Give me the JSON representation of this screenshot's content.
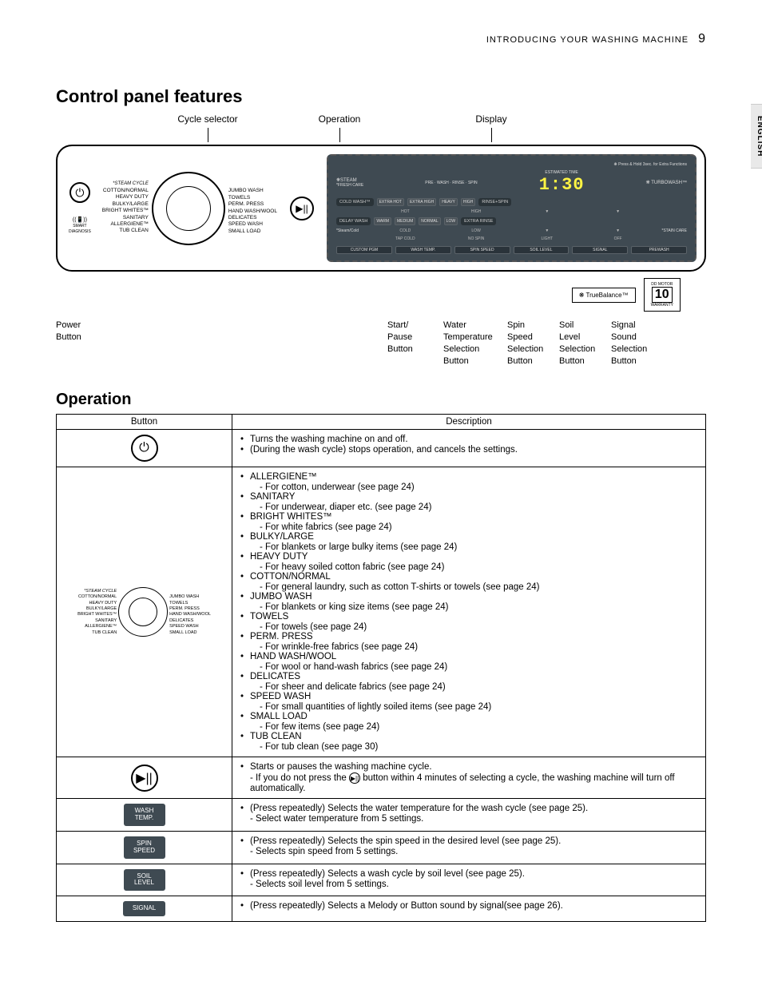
{
  "header": {
    "section": "INTRODUCING YOUR WASHING MACHINE",
    "page": "9"
  },
  "lang_tab": "ENGLISH",
  "h_panel": "Control panel features",
  "top_labels": {
    "cycle": "Cycle selector",
    "operation": "Operation",
    "display": "Display"
  },
  "cycles_header": "*STEAM CYCLE",
  "cycles_left": [
    "COTTON/NORMAL",
    "HEAVY DUTY",
    "BULKY/LARGE",
    "BRIGHT WHITES™",
    "SANITARY",
    "ALLERGIENE™",
    "TUB CLEAN"
  ],
  "cycles_right": [
    "JUMBO WASH",
    "TOWELS",
    "PERM. PRESS",
    "HAND WASH/WOOL",
    "DELICATES",
    "SPEED WASH",
    "SMALL LOAD"
  ],
  "start_glyph": "▶||",
  "display": {
    "time": "1:30",
    "hold_note": "❋ Press & Hold 3sec. for Extra Functions",
    "steam": "❋STEAM",
    "fresh": "*FRESH CARE",
    "progress": "PRE · WASH · RINSE · SPIN",
    "est_label": "ESTIMATED TIME",
    "turbo": "❋ TURBOWASH™",
    "left_btns": [
      "COLD WASH™",
      "DELAY WASH",
      "CUSTOM PGM"
    ],
    "right_btns": [
      "RINSE+SPIN",
      "EXTRA RINSE",
      "PREWASH"
    ],
    "sub_left": "*Steam/Cold",
    "sub_right": "*STAIN CARE",
    "grid_headers": [
      "EXTRA HOT",
      "EXTRA HIGH",
      "HEAVY",
      "HIGH"
    ],
    "grid_r2": [
      "HOT",
      "HIGH",
      "▼",
      "▼"
    ],
    "grid_r3": [
      "WARM",
      "MEDIUM",
      "NORMAL",
      "LOW"
    ],
    "grid_r4": [
      "COLD",
      "LOW",
      "▼",
      "▼"
    ],
    "grid_r5": [
      "TAP COLD",
      "NO SPIN",
      "LIGHT",
      "OFF"
    ],
    "bottom_btns": [
      "WASH\nTEMP.",
      "SPIN\nSPEED",
      "SOIL\nLEVEL",
      "SIGNAL"
    ]
  },
  "badges": {
    "tb": "TrueBalance™",
    "warranty_years": "10",
    "warranty_sub": "WARRANTY",
    "motor": "DD MOTOR"
  },
  "callouts": {
    "power": "Power\nButton",
    "start": "Start/\nPause\nButton",
    "water": "Water\nTemperature\nSelection\nButton",
    "spin": "Spin\nSpeed\nSelection\nButton",
    "soil": "Soil\nLevel\nSelection\nButton",
    "signal": "Signal\nSound\nSelection\nButton"
  },
  "h_operation": "Operation",
  "table_headers": {
    "btn": "Button",
    "desc": "Description"
  },
  "rows": {
    "power": {
      "b1": "Turns the washing machine on and off.",
      "b2": "(During the wash cycle) stops operation, and cancels the settings."
    },
    "selector": [
      {
        "t": "ALLERGIENE™",
        "d": "- For cotton, underwear (see page 24)"
      },
      {
        "t": "SANITARY",
        "d": "- For underwear, diaper etc. (see page 24)"
      },
      {
        "t": "BRIGHT WHITES™",
        "d": "- For white fabrics (see page 24)"
      },
      {
        "t": "BULKY/LARGE",
        "d": "- For blankets or large bulky items (see page 24)"
      },
      {
        "t": "HEAVY DUTY",
        "d": "- For heavy soiled cotton fabric (see page 24)"
      },
      {
        "t": "COTTON/NORMAL",
        "d": "- For general laundry, such as cotton T-shirts or towels (see page 24)"
      },
      {
        "t": "JUMBO WASH",
        "d": "- For blankets or king size items (see page 24)"
      },
      {
        "t": "TOWELS",
        "d": "- For towels (see page 24)"
      },
      {
        "t": "PERM. PRESS",
        "d": "- For wrinkle-free fabrics (see page 24)"
      },
      {
        "t": "HAND WASH/WOOL ",
        "d": "- For wool or hand-wash fabrics (see page 24)"
      },
      {
        "t": "DELICATES",
        "d": "- For sheer and delicate fabrics (see page 24)"
      },
      {
        "t": "SPEED WASH",
        "d": "- For small quantities of lightly soiled items (see page 24)"
      },
      {
        "t": "SMALL LOAD",
        "d": "- For few items (see page 24)"
      },
      {
        "t": "TUB CLEAN",
        "d": "- For tub clean (see page 30)"
      }
    ],
    "start": {
      "b1": "Starts or pauses the washing machine cycle.",
      "b2_a": "- If you do not press the ",
      "b2_b": " button within 4 minutes of selecting a cycle, the washing machine will turn off automatically."
    },
    "wash": {
      "label": "WASH\nTEMP.",
      "b1": "(Press repeatedly) Selects the water temperature for the wash cycle (see page 25).",
      "b2": "- Select water temperature from 5 settings."
    },
    "spin": {
      "label": "SPIN\nSPEED",
      "b1": "(Press repeatedly) Selects the spin speed in the desired level (see page 25).",
      "b2": "- Selects spin speed from 5 settings."
    },
    "soil": {
      "label": "SOIL\nLEVEL",
      "b1": "(Press repeatedly) Selects a wash cycle by soil level (see page 25).",
      "b2": "- Selects soil level from 5 settings."
    },
    "signal": {
      "label": "SIGNAL",
      "b1": "(Press repeatedly) Selects a Melody or Button sound by signal(see page 26)."
    }
  }
}
